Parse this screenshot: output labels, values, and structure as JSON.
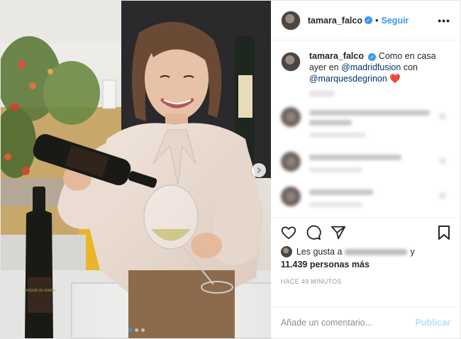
{
  "post": {
    "username": "tamara_falco",
    "follow_label": "Seguir",
    "separator": "•",
    "more_label": "•••",
    "verified_glyph": "✓"
  },
  "caption": {
    "username": "tamara_falco",
    "text_before": "Como en casa ayer en",
    "mention_1": "@madridfusion",
    "text_middle": "con",
    "mention_2": "@marquesdegrinon",
    "emoji": "❤️"
  },
  "comments_count": 3,
  "actions": {
    "icons": [
      "heart-outline-icon",
      "comment-bubble-icon",
      "share-paper-plane-icon",
      "bookmark-icon"
    ],
    "likes_prefix": "Les gusta a",
    "likes_and": "y",
    "likes_count": "11.439 personas más",
    "time": "HACE 49 MINUTOS"
  },
  "add_comment": {
    "placeholder": "Añade un comentario...",
    "publish_label": "Publicar"
  },
  "carousel": {
    "slides": 3,
    "active_index": 0
  },
  "photo": {
    "bottle_label": "MARQUÉS DE GRIÑÓN",
    "colors": {
      "blouse": "#eadcd3",
      "background_panel": "#2a2a2c",
      "booth_yellow": "#e8b62a",
      "oil": "#c9c37a"
    }
  },
  "colors": {
    "accent": "#3897f0",
    "mention": "#003569",
    "publish_disabled": "#b2dffc",
    "heart": "#ed4956"
  }
}
